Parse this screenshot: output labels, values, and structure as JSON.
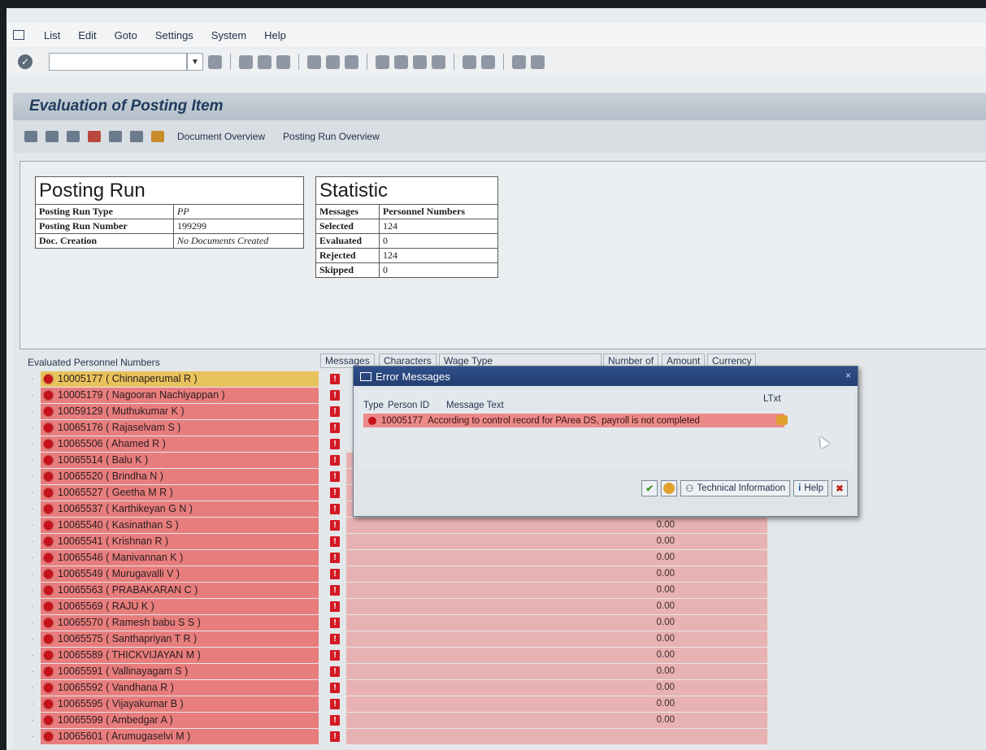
{
  "menu": {
    "items": [
      "List",
      "Edit",
      "Goto",
      "Settings",
      "System",
      "Help"
    ]
  },
  "title": "Evaluation of Posting Item",
  "app_toolbar": {
    "document_overview": "Document Overview",
    "posting_run_overview": "Posting Run Overview"
  },
  "posting_run": {
    "heading": "Posting Run",
    "rows": [
      {
        "label": "Posting Run Type",
        "value": "PP"
      },
      {
        "label": "Posting Run Number",
        "value": "199299"
      },
      {
        "label": "Doc. Creation",
        "value": "No Documents Created"
      }
    ]
  },
  "statistic": {
    "heading": "Statistic",
    "col1": "Messages",
    "col2": "Personnel Numbers",
    "rows": [
      {
        "label": "Selected",
        "value": "124"
      },
      {
        "label": "Evaluated",
        "value": "0"
      },
      {
        "label": "Rejected",
        "value": "124"
      },
      {
        "label": "Skipped",
        "value": "0"
      }
    ]
  },
  "list": {
    "headers": {
      "evaluated": "Evaluated Personnel Numbers",
      "messages": "Messages",
      "characters": "Characters",
      "wage_type": "Wage Type",
      "number_of": "Number of",
      "amount": "Amount",
      "currency": "Currency"
    },
    "message_icon": "!",
    "rows": [
      {
        "id": "10005177",
        "name": "Chinnaperumal R",
        "amount": ""
      },
      {
        "id": "10005179",
        "name": "Nagooran Nachiyappan",
        "amount": ""
      },
      {
        "id": "10059129",
        "name": "Muthukumar K",
        "amount": ""
      },
      {
        "id": "10065176",
        "name": "Rajaselvam S",
        "amount": ""
      },
      {
        "id": "10065506",
        "name": "Ahamed R",
        "amount": ""
      },
      {
        "id": "10065514",
        "name": "Balu K",
        "amount": ""
      },
      {
        "id": "10065520",
        "name": "Brindha N",
        "amount": ""
      },
      {
        "id": "10065527",
        "name": "Geetha M R",
        "amount": ""
      },
      {
        "id": "10065537",
        "name": "Karthikeyan G N",
        "amount": ""
      },
      {
        "id": "10065540",
        "name": "Kasinathan S",
        "amount": "0.00"
      },
      {
        "id": "10065541",
        "name": "Krishnan R",
        "amount": "0.00"
      },
      {
        "id": "10065546",
        "name": "Manivannan K",
        "amount": "0.00"
      },
      {
        "id": "10065549",
        "name": "Murugavalli V",
        "amount": "0.00"
      },
      {
        "id": "10065563",
        "name": "PRABAKARAN C",
        "amount": "0.00"
      },
      {
        "id": "10065569",
        "name": "RAJU K",
        "amount": "0.00"
      },
      {
        "id": "10065570",
        "name": "Ramesh babu S S",
        "amount": "0.00"
      },
      {
        "id": "10065575",
        "name": "Santhapriyan T R",
        "amount": "0.00"
      },
      {
        "id": "10065589",
        "name": "THICKVIJAYAN M",
        "amount": "0.00"
      },
      {
        "id": "10065591",
        "name": "Vallinayagam S",
        "amount": "0.00"
      },
      {
        "id": "10065592",
        "name": "Vandhana R",
        "amount": "0.00"
      },
      {
        "id": "10065595",
        "name": "Vijayakumar B",
        "amount": "0.00"
      },
      {
        "id": "10065599",
        "name": "Ambedgar A",
        "amount": "0.00"
      },
      {
        "id": "10065601",
        "name": "Arumugaselvi M",
        "amount": ""
      }
    ]
  },
  "dialog": {
    "title": "Error Messages",
    "headers": {
      "type": "Type",
      "person_id": "Person ID",
      "message_text": "Message Text",
      "ltxt": "LTxt"
    },
    "row": {
      "person_id": "10005177",
      "message": "According to control record for PArea DS, payroll is not completed"
    },
    "buttons": {
      "technical_information": "Technical Information",
      "help": "Help"
    },
    "close": "×"
  },
  "colors": {
    "error_row": "#e87d7d",
    "selected_row": "#e8c25c",
    "dialog_title": "#2f4f88"
  }
}
